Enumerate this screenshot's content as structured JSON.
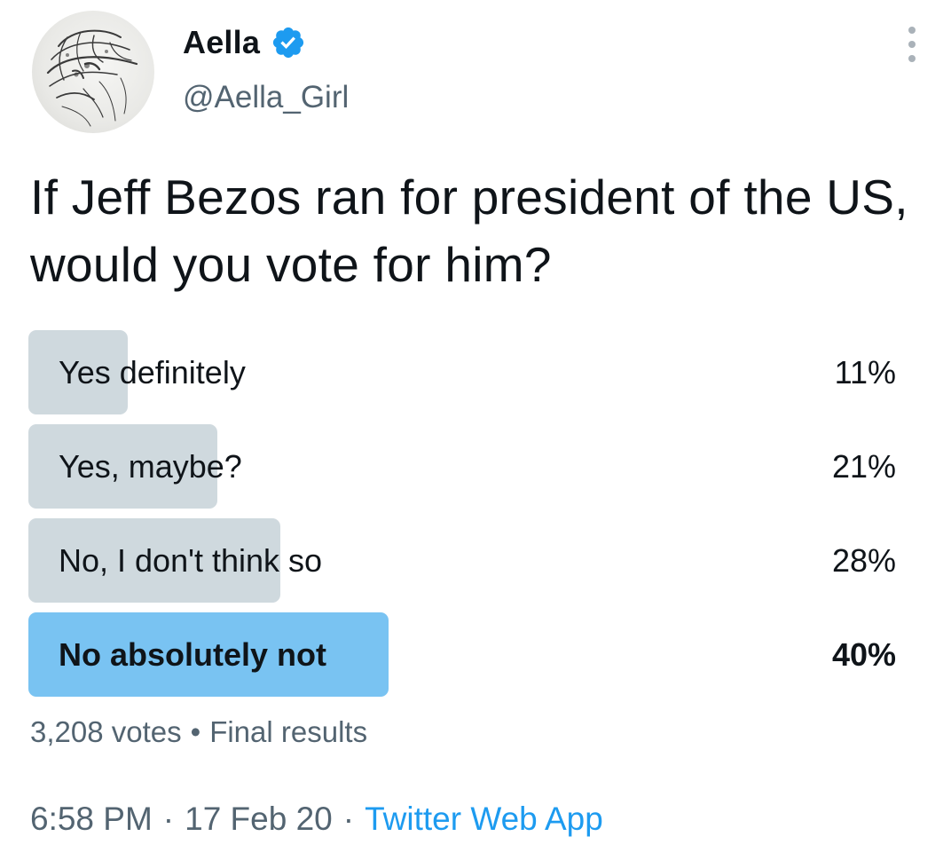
{
  "author": {
    "display_name": "Aella",
    "handle": "@Aella_Girl",
    "verified": true,
    "avatar_icon": "sketch-portrait-avatar"
  },
  "tweet": {
    "text": "If Jeff Bezos ran for president of the US, would you vote for him?"
  },
  "poll": {
    "options": [
      {
        "label": "Yes definitely",
        "percent_text": "11%",
        "percent": 11,
        "winner": false
      },
      {
        "label": "Yes, maybe?",
        "percent_text": "21%",
        "percent": 21,
        "winner": false
      },
      {
        "label": "No, I don't think so",
        "percent_text": "28%",
        "percent": 28,
        "winner": false
      },
      {
        "label": "No absolutely not",
        "percent_text": "40%",
        "percent": 40,
        "winner": true
      }
    ],
    "votes": "3,208 votes",
    "separator": "•",
    "status": "Final results"
  },
  "footer": {
    "time": "6:58 PM",
    "dot": "·",
    "date": "17 Feb 20",
    "source": "Twitter Web App"
  },
  "colors": {
    "bar": "#cfd9de",
    "winner_bar": "#79c3f2",
    "link": "#1d9bf0",
    "verified": "#1d9bf0",
    "muted": "#536471"
  }
}
